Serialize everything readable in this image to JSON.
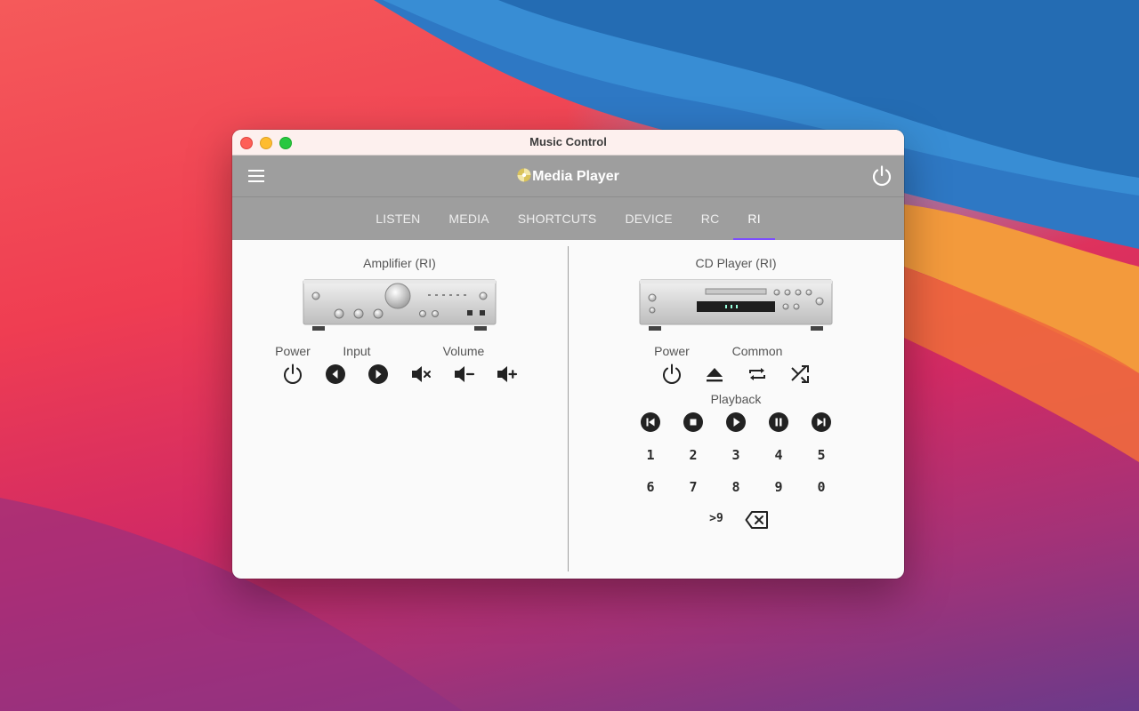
{
  "window": {
    "title": "Music Control"
  },
  "appbar": {
    "title": "Media Player",
    "menu_icon": "hamburger-menu-icon",
    "power_icon": "power-icon"
  },
  "tabs": [
    {
      "label": "LISTEN",
      "active": false
    },
    {
      "label": "MEDIA",
      "active": false
    },
    {
      "label": "SHORTCUTS",
      "active": false
    },
    {
      "label": "DEVICE",
      "active": false
    },
    {
      "label": "RC",
      "active": false
    },
    {
      "label": "RI",
      "active": true
    }
  ],
  "amplifier": {
    "title": "Amplifier (RI)",
    "power_label": "Power",
    "input_label": "Input",
    "volume_label": "Volume"
  },
  "cd_player": {
    "title": "CD Player (RI)",
    "power_label": "Power",
    "common_label": "Common",
    "playback_label": "Playback",
    "digits_row1": [
      "1",
      "2",
      "3",
      "4",
      "5"
    ],
    "digits_row2": [
      "6",
      "7",
      "8",
      "9",
      "0"
    ],
    "greater_nine": ">9"
  },
  "colors": {
    "accent": "#7c4dff",
    "appbar": "#9e9e9e",
    "icon": "#222222"
  }
}
